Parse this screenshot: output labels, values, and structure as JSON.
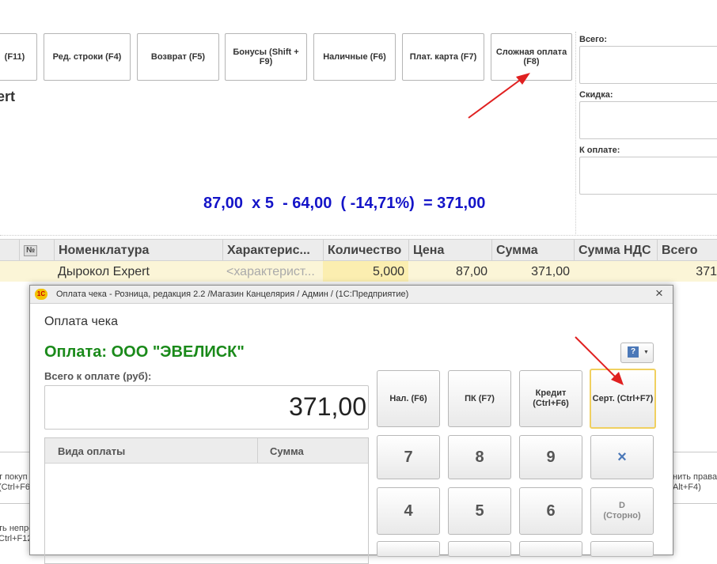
{
  "toolbar": {
    "buttons": [
      {
        "label": "(F11)"
      },
      {
        "label": "Ред. строки (F4)"
      },
      {
        "label": "Возврат (F5)"
      },
      {
        "label": "Бонусы (Shift + F9)"
      },
      {
        "label": "Наличные (F6)"
      },
      {
        "label": "Плат. карта (F7)"
      },
      {
        "label": "Сложная оплата (F8)"
      }
    ]
  },
  "product_title_fragment": "ert",
  "totals": {
    "total_label": "Всего:",
    "discount_label": "Скидка:",
    "to_pay_label": "К оплате:"
  },
  "formula": "87,00  x 5  - 64,00  ( -14,71%)  = 371,00",
  "table": {
    "columns": [
      "№",
      "Номенклатура",
      "Характерис...",
      "Количество",
      "Цена",
      "Сумма",
      "Сумма НДС",
      "Всего"
    ],
    "row": {
      "name": "Дырокол Expert",
      "characteristic": "<характерист...",
      "quantity": "5,000",
      "price": "87,00",
      "sum": "371,00",
      "vat": "",
      "total": "371"
    }
  },
  "background_texts": {
    "left1": "т покуп",
    "left2": "(Ctrl+F6)",
    "left3": "ть непро",
    "left4": "Ctrl+F12",
    "right1": "нить права",
    "right2": "Alt+F4)"
  },
  "dialog": {
    "title": "Оплата чека - Розница, редакция 2.2 /Магазин Канцелярия / Админ /  (1С:Предприятие)",
    "app_badge": "1С",
    "header": "Оплата чека",
    "payer": "Оплата: ООО \"ЭВЕЛИСК\"",
    "amount_label": "Всего к оплате (руб):",
    "amount": "371,00",
    "payments_table": {
      "col1": "Вида оплаты",
      "col2": "Сумма"
    },
    "help_button": "?",
    "close": "×",
    "keys": {
      "cash": "Нал. (F6)",
      "card": "ПК (F7)",
      "credit": "Кредит (Ctrl+F6)",
      "cert": "Серт. (Ctrl+F7)",
      "k7": "7",
      "k8": "8",
      "k9": "9",
      "clear": "×",
      "k4": "4",
      "k5": "5",
      "k6": "6",
      "storno": "D (Сторно)"
    }
  },
  "colors": {
    "arrow": "#e02020",
    "formula": "#1414c8",
    "payer": "#1a8a1a",
    "row_highlight": "#fbf5d7"
  }
}
